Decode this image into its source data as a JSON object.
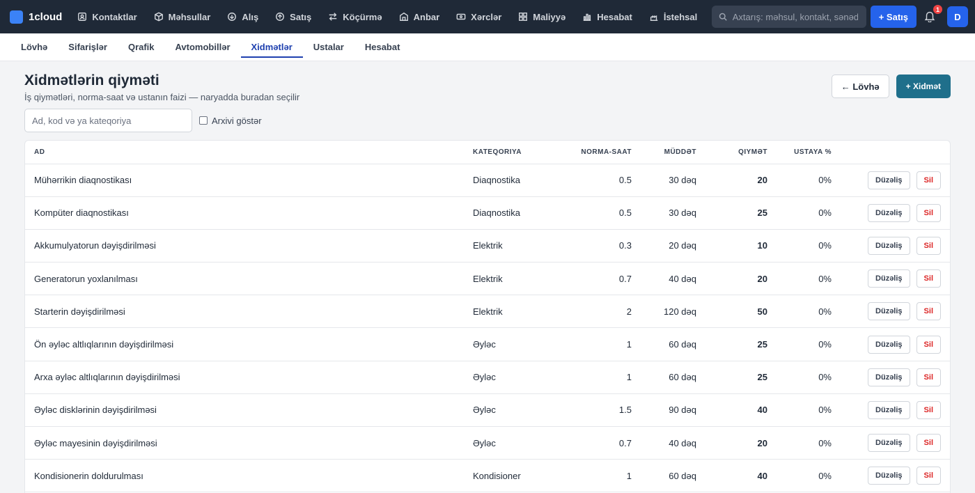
{
  "brand": {
    "name": "1cloud"
  },
  "nav": [
    {
      "label": "Kontaktlar",
      "icon": "contacts-icon"
    },
    {
      "label": "Məhsullar",
      "icon": "box-icon"
    },
    {
      "label": "Alış",
      "icon": "purchase-icon"
    },
    {
      "label": "Satış",
      "icon": "sale-icon"
    },
    {
      "label": "Köçürmə",
      "icon": "transfer-icon"
    },
    {
      "label": "Anbar",
      "icon": "warehouse-icon"
    },
    {
      "label": "Xərclər",
      "icon": "expenses-icon"
    },
    {
      "label": "Maliyyə",
      "icon": "finance-icon"
    },
    {
      "label": "Hesabat",
      "icon": "report-icon"
    },
    {
      "label": "İstehsal",
      "icon": "production-icon"
    }
  ],
  "search": {
    "placeholder": "Axtarış: məhsul, kontakt, sənəd..."
  },
  "topbar": {
    "sale_button": "+ Satış",
    "notification_count": "1",
    "avatar_letter": "D"
  },
  "tabs": [
    {
      "label": "Lövhə",
      "active": false
    },
    {
      "label": "Sifarişlər",
      "active": false
    },
    {
      "label": "Qrafik",
      "active": false
    },
    {
      "label": "Avtomobillər",
      "active": false
    },
    {
      "label": "Xidmətlər",
      "active": true
    },
    {
      "label": "Ustalar",
      "active": false
    },
    {
      "label": "Hesabat",
      "active": false
    }
  ],
  "page": {
    "title": "Xidmətlərin qiyməti",
    "subtitle": "İş qiymətləri, norma-saat və ustanın faizi — naryadda buradan seçilir",
    "back_button": "← Lövhə",
    "add_button": "+ Xidmət"
  },
  "filters": {
    "search_placeholder": "Ad, kod və ya kateqoriya",
    "archive_label": "Arxivi göstər"
  },
  "table": {
    "headers": {
      "name": "Ad",
      "category": "Kateqoriya",
      "norm_hour": "Norma-saat",
      "duration": "Müddət",
      "price": "Qiymət",
      "master_pct": "Ustaya %"
    },
    "edit_label": "Düzəliş",
    "delete_label": "Sil",
    "rows": [
      {
        "name": "Mühərrikin diaqnostikası",
        "category": "Diaqnostika",
        "norm_hour": "0.5",
        "duration": "30 dəq",
        "price": "20",
        "master_pct": "0%"
      },
      {
        "name": "Kompüter diaqnostikası",
        "category": "Diaqnostika",
        "norm_hour": "0.5",
        "duration": "30 dəq",
        "price": "25",
        "master_pct": "0%"
      },
      {
        "name": "Akkumulyatorun dəyişdirilməsi",
        "category": "Elektrik",
        "norm_hour": "0.3",
        "duration": "20 dəq",
        "price": "10",
        "master_pct": "0%"
      },
      {
        "name": "Generatorun yoxlanılması",
        "category": "Elektrik",
        "norm_hour": "0.7",
        "duration": "40 dəq",
        "price": "20",
        "master_pct": "0%"
      },
      {
        "name": "Starterin dəyişdirilməsi",
        "category": "Elektrik",
        "norm_hour": "2",
        "duration": "120 dəq",
        "price": "50",
        "master_pct": "0%"
      },
      {
        "name": "Ön əyləc altlıqlarının dəyişdirilməsi",
        "category": "Əyləc",
        "norm_hour": "1",
        "duration": "60 dəq",
        "price": "25",
        "master_pct": "0%"
      },
      {
        "name": "Arxa əyləc altlıqlarının dəyişdirilməsi",
        "category": "Əyləc",
        "norm_hour": "1",
        "duration": "60 dəq",
        "price": "25",
        "master_pct": "0%"
      },
      {
        "name": "Əyləc disklərinin dəyişdirilməsi",
        "category": "Əyləc",
        "norm_hour": "1.5",
        "duration": "90 dəq",
        "price": "40",
        "master_pct": "0%"
      },
      {
        "name": "Əyləc mayesinin dəyişdirilməsi",
        "category": "Əyləc",
        "norm_hour": "0.7",
        "duration": "40 dəq",
        "price": "20",
        "master_pct": "0%"
      },
      {
        "name": "Kondisionerin doldurulması",
        "category": "Kondisioner",
        "norm_hour": "1",
        "duration": "60 dəq",
        "price": "40",
        "master_pct": "0%"
      }
    ]
  },
  "colors": {
    "topbar": "#1f2937",
    "primary": "#2563eb",
    "teal": "#1f6f8b",
    "danger": "#dc2626"
  }
}
